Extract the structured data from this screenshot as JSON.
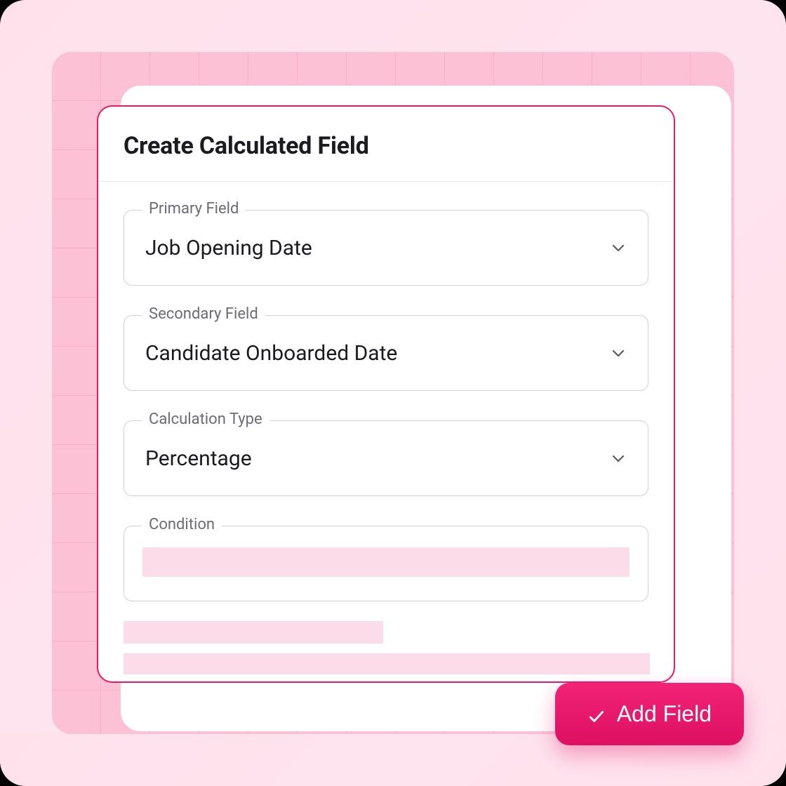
{
  "modal": {
    "title": "Create Calculated Field",
    "fields": {
      "primary": {
        "label": "Primary Field",
        "value": "Job Opening Date"
      },
      "secondary": {
        "label": "Secondary Field",
        "value": "Candidate Onboarded Date"
      },
      "calcType": {
        "label": "Calculation Type",
        "value": "Percentage"
      },
      "condition": {
        "label": "Condition"
      }
    }
  },
  "actions": {
    "addField": "Add Field"
  }
}
